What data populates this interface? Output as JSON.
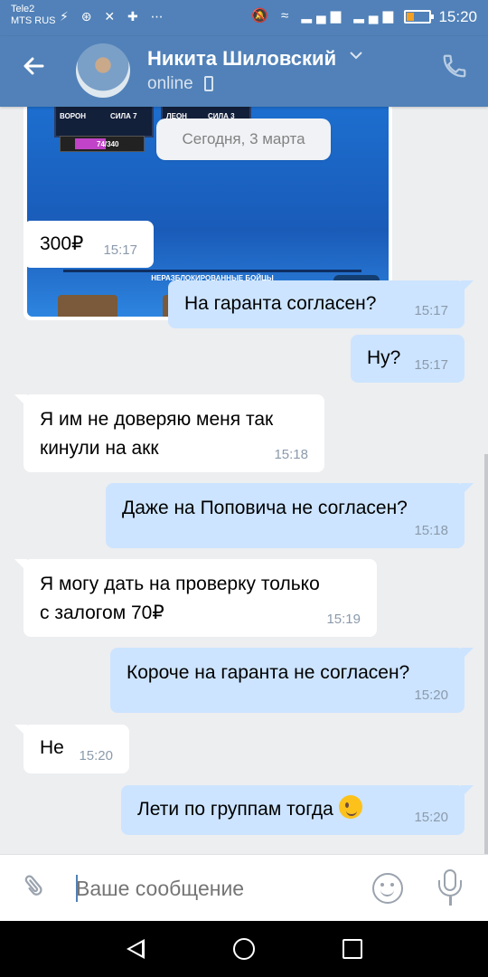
{
  "statusbar": {
    "carrier_line1": "Tele2",
    "carrier_line2": "MTS RUS",
    "time": "15:20",
    "left_icons": "⚡ ⊛ ✕ ✚ ⋯",
    "right_icons": "🔕 ≈ ▂▄▆ ▂▄▆",
    "battery_color": "#f4a023",
    "battery_level": 0.3
  },
  "header": {
    "contact_name": "Никита Шиловский",
    "status": "online",
    "accent_color": "#5181b8"
  },
  "date_separator": "Сегодня, 3 марта",
  "image_message": {
    "game_card_1": "ВОРОН",
    "game_card_1_power": "СИЛА 7",
    "game_card_2": "ЛЕОН",
    "game_card_2_power": "СИЛА 3",
    "progress_text": "74/340",
    "section_title": "НЕРАЗБЛОКИРОВАННЫЕ БОЙЦЫ",
    "time": "15:17"
  },
  "messages": [
    {
      "dir": "in",
      "text": "300₽",
      "time": "15:17"
    },
    {
      "dir": "out",
      "text": "На гаранта согласен?",
      "time": "15:17"
    },
    {
      "dir": "out",
      "text": "Ну?",
      "time": "15:17"
    },
    {
      "dir": "in",
      "line1": "Я им не доверяю меня так",
      "line2": "кинули на акк",
      "time": "15:18"
    },
    {
      "dir": "out",
      "text": "Даже на Поповича не согласен?",
      "time": "15:18"
    },
    {
      "dir": "in",
      "line1": "Я могу дать на проверку только",
      "line2": "с залогом 70₽",
      "time": "15:19"
    },
    {
      "dir": "out",
      "text": "Короче на гаранта не согласен?",
      "time": "15:20"
    },
    {
      "dir": "in",
      "text": "Не",
      "time": "15:20"
    },
    {
      "dir": "out",
      "text": "Лети по группам тогда",
      "emoji": "winking-face",
      "time": "15:20"
    }
  ],
  "composer": {
    "placeholder": "Ваше сообщение"
  },
  "colors": {
    "incoming_bubble": "#ffffff",
    "outgoing_bubble": "#cce4ff",
    "background": "#edeef0"
  }
}
